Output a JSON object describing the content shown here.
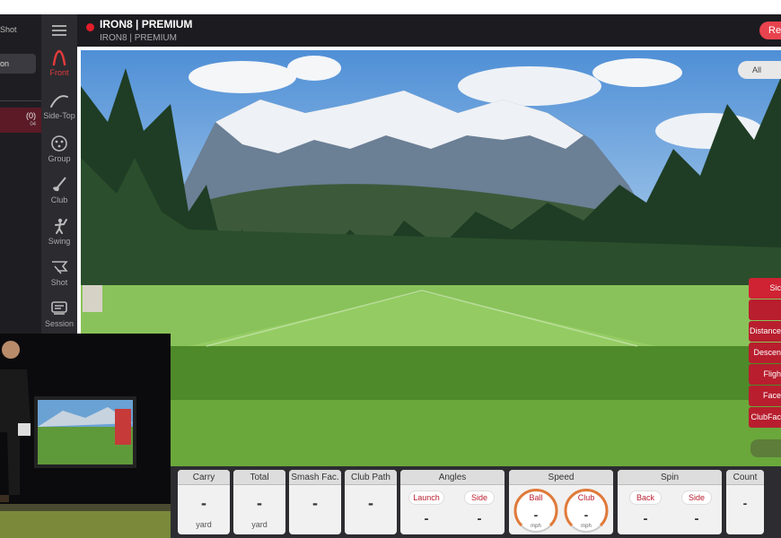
{
  "left_panel": {
    "header": "Shot",
    "selected": "on",
    "row_count": "(0)",
    "row_sub": "04"
  },
  "nav": {
    "items": [
      {
        "label": "Front",
        "icon": "trajectory-front-icon",
        "active": true
      },
      {
        "label": "Side-Top",
        "icon": "trajectory-side-icon",
        "active": false
      },
      {
        "label": "Group",
        "icon": "group-icon",
        "active": false
      },
      {
        "label": "Club",
        "icon": "club-icon",
        "active": false
      },
      {
        "label": "Swing",
        "icon": "swing-icon",
        "active": false
      },
      {
        "label": "Shot",
        "icon": "shot-icon",
        "active": false
      },
      {
        "label": "Session",
        "icon": "session-icon",
        "active": false
      }
    ]
  },
  "header": {
    "title": "IRON8 | PREMIUM",
    "subtitle": "IRON8 | PREMIUM",
    "right_button": "Re",
    "status_color": "#e21d2a"
  },
  "scene": {
    "filter_pill": "All"
  },
  "right_stats": {
    "items": [
      "Sic",
      "",
      "Distance",
      "Descen",
      "Fligh",
      "Face",
      "ClubFac"
    ]
  },
  "metrics": {
    "carry": {
      "title": "Carry",
      "value": "-",
      "unit": "yard"
    },
    "total": {
      "title": "Total",
      "value": "-",
      "unit": "yard"
    },
    "smash": {
      "title": "Smash Fac.",
      "value": "-"
    },
    "club_path": {
      "title": "Club Path",
      "value": "-"
    },
    "angles": {
      "title": "Angles",
      "launch_label": "Launch",
      "launch_value": "-",
      "side_label": "Side",
      "side_value": "-"
    },
    "speed": {
      "title": "Speed",
      "ball_label": "Ball",
      "ball_value": "-",
      "ball_unit": "mph",
      "club_label": "Club",
      "club_value": "-",
      "club_unit": "mph"
    },
    "spin": {
      "title": "Spin",
      "back_label": "Back",
      "back_value": "-",
      "side_label": "Side",
      "side_value": "-"
    },
    "count": {
      "title": "Count",
      "value": "-"
    }
  },
  "colors": {
    "accent": "#b81e2e",
    "gauge": "#e07a3a",
    "nav_bg": "#2b2b30"
  }
}
